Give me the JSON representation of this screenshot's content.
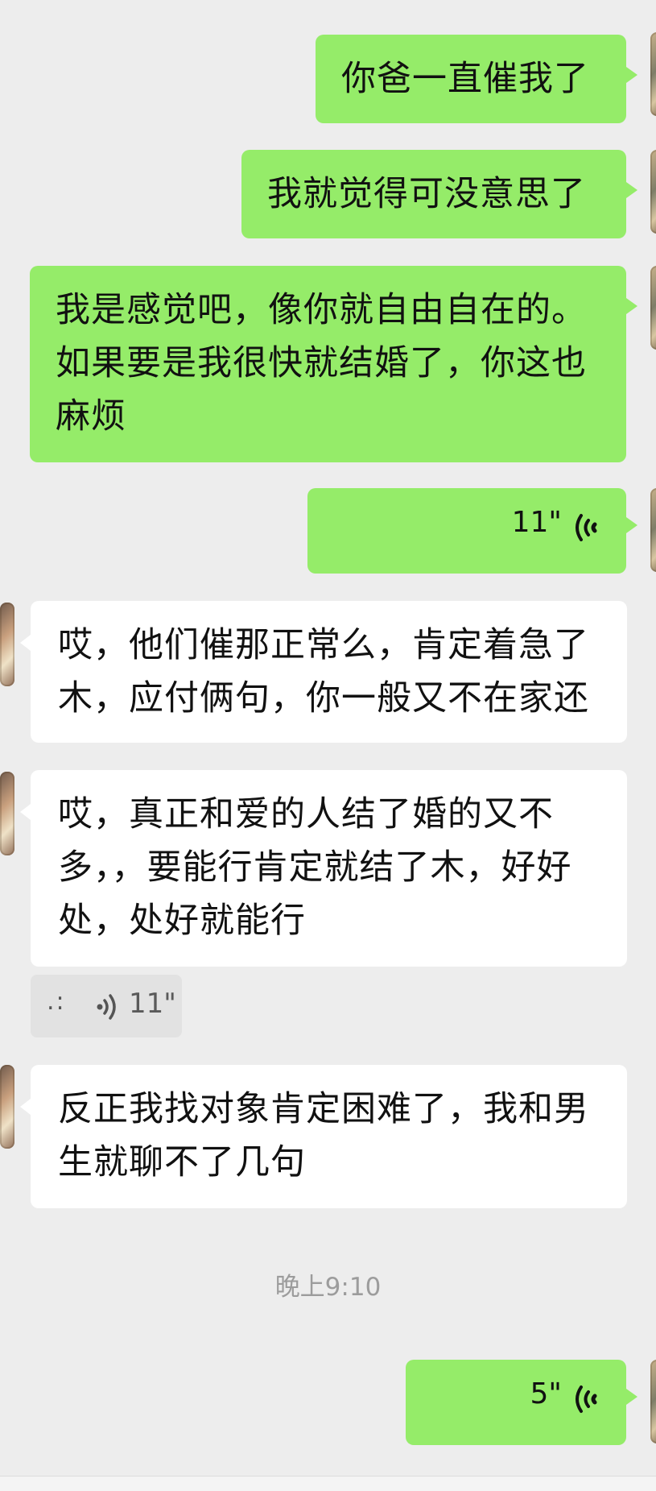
{
  "messages": {
    "m1": "你爸一直催我了",
    "m2": "我就觉得可没意思了",
    "m3": "我是感觉吧，像你就自由自在的。如果要是我很快就结婚了，你这也麻烦",
    "v1_duration": "11\"",
    "m4": "哎，他们催那正常么，肯定着急了木，应付俩句，你一般又不在家还",
    "m5": "哎，真正和爱的人结了婚的又不多，，要能行肯定就结了木，好好处，处好就能行",
    "transcript_dots": ".:",
    "transcript_duration": "11\"",
    "m6": "反正我找对象肯定困难了，我和男生就聊不了几句",
    "timestamp": "晚上9:10",
    "v2_duration": "5\""
  },
  "icons": {
    "voice": "voice-wave-icon",
    "transcript": "speaker-icon"
  },
  "colors": {
    "background": "#ededed",
    "outgoing_bubble": "#95ec69",
    "incoming_bubble": "#ffffff",
    "timestamp_text": "#9c9c9c"
  }
}
